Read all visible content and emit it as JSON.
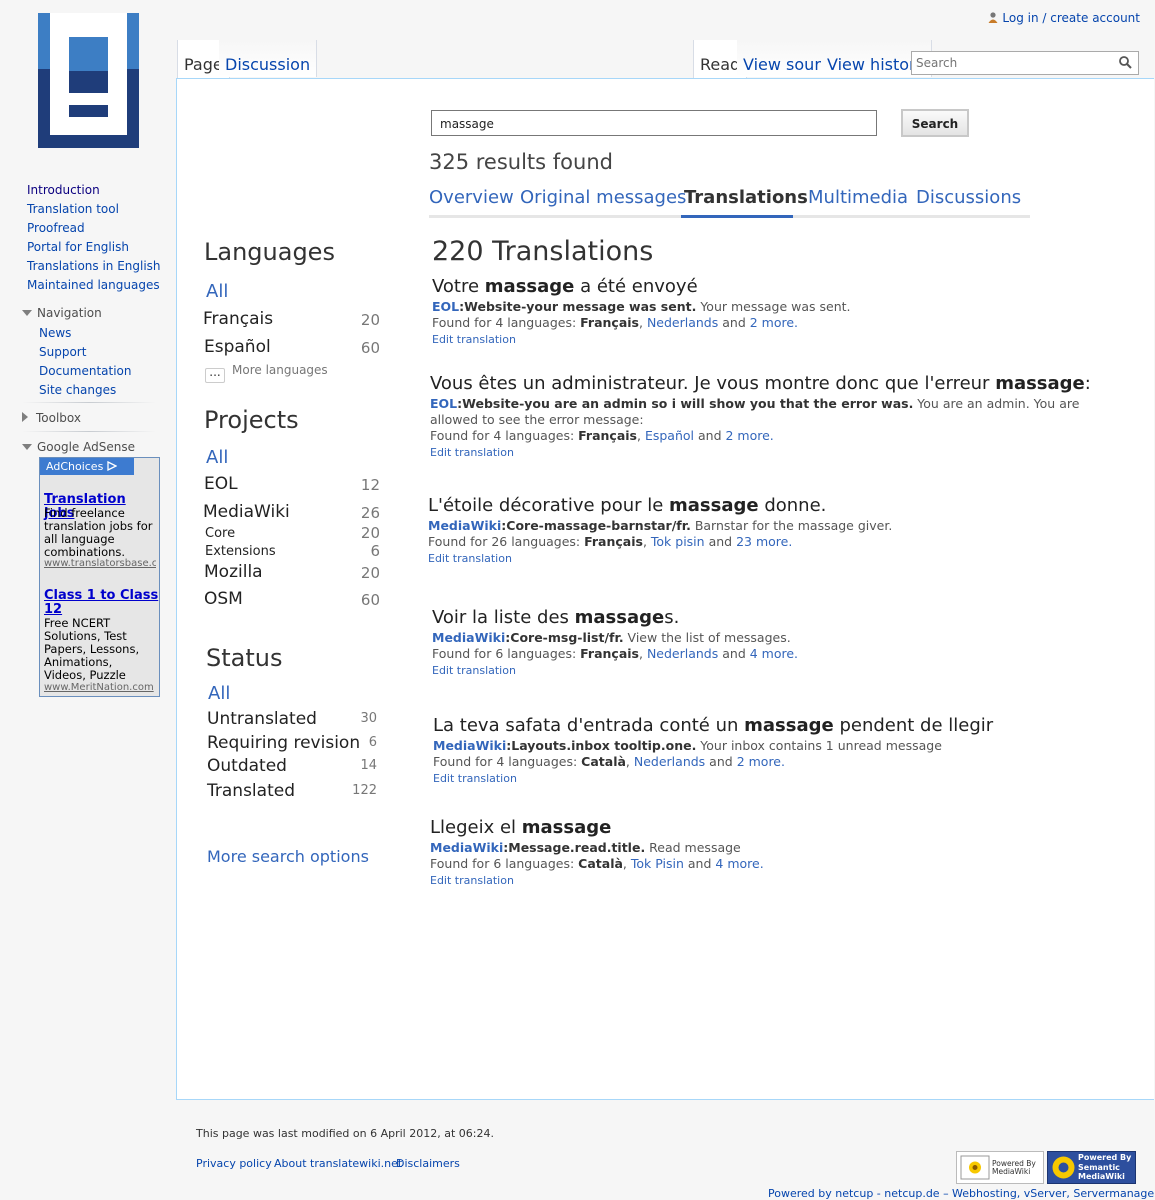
{
  "personal": {
    "login": "Log in / create account"
  },
  "tabs": {
    "page": "Page",
    "discussion": "Discussion",
    "read": "Read",
    "view_source": "View source",
    "view_history": "View history"
  },
  "top_search": {
    "placeholder": "Search"
  },
  "sidebar": {
    "main": [
      "Introduction",
      "Translation tool",
      "Proofread",
      "Portal for English",
      "Translations in English",
      "Maintained languages"
    ],
    "navigation": {
      "title": "Navigation",
      "items": [
        "News",
        "Support",
        "Documentation",
        "Site changes"
      ]
    },
    "toolbox": "Toolbox",
    "adsense": "Google AdSense"
  },
  "ad": {
    "choices": "AdChoices",
    "ad1": {
      "title": "Translation jobs",
      "text": "Find freelance translation jobs for all language combinations.",
      "url": "www.translatorsbase.com"
    },
    "ad2": {
      "title": "Class 1 to Class 12",
      "text": "Free NCERT Solutions, Test Papers, Lessons, Animations, Videos, Puzzle",
      "url": "www.MeritNation.com"
    }
  },
  "search": {
    "query": "massage",
    "button": "Search",
    "count": "325 results found",
    "tabs": [
      "Overview",
      "Original messages",
      "Translations",
      "Multimedia",
      "Discussions"
    ]
  },
  "facets": {
    "languages": {
      "title": "Languages",
      "all": "All",
      "items": [
        {
          "label": "Français",
          "count": "20"
        },
        {
          "label": "Español",
          "count": "60"
        }
      ],
      "more": "More languages",
      "dots": "..."
    },
    "projects": {
      "title": "Projects",
      "all": "All",
      "items": [
        {
          "label": "EOL",
          "count": "12"
        },
        {
          "label": "MediaWiki",
          "count": "26"
        },
        {
          "label": "Core",
          "count": "20"
        },
        {
          "label": "Extensions",
          "count": "6"
        },
        {
          "label": "Mozilla",
          "count": "20"
        },
        {
          "label": "OSM",
          "count": "60"
        }
      ]
    },
    "status": {
      "title": "Status",
      "all": "All",
      "items": [
        {
          "label": "Untranslated",
          "count": "30"
        },
        {
          "label": "Requiring revision",
          "count": "6"
        },
        {
          "label": "Outdated",
          "count": "14"
        },
        {
          "label": "Translated",
          "count": "122"
        }
      ]
    },
    "more_options": "More search options"
  },
  "results": {
    "heading": "220 Translations",
    "edit_label": "Edit translation",
    "found_for": "Found for",
    "and": "and",
    "items": [
      {
        "pre": "Votre ",
        "bold": "massage",
        "post": " a été envoyé",
        "project": "EOL",
        "key": ":Website-your message was sent.",
        "desc": " Your message was sent.",
        "desc2": "",
        "langs": "4 languages:",
        "lang1": "Français",
        "lang2": "Nederlands",
        "more": "2 more."
      },
      {
        "pre": "Vous êtes un administrateur. Je vous montre donc que l'erreur ",
        "bold": "massage",
        "post": ":",
        "project": "EOL",
        "key": ":Website-you are an admin so i will show you that the error was.",
        "desc": " You are an admin. You are",
        "desc2": "allowed to see the error message:",
        "langs": "4 languages:",
        "lang1": "Français",
        "lang2": "Español",
        "more": "2 more."
      },
      {
        "pre": "L'étoile décorative pour le ",
        "bold": "massage",
        "post": " donne.",
        "project": "MediaWiki",
        "key": ":Core-massage-barnstar/fr.",
        "desc": " Barnstar for the massage giver.",
        "desc2": "",
        "langs": "26 languages:",
        "lang1": "Français",
        "lang2": "Tok pisin",
        "more": "23 more."
      },
      {
        "pre": "Voir la liste des ",
        "bold": "massage",
        "post": "s.",
        "project": "MediaWiki",
        "key": ":Core-msg-list/fr.",
        "desc": " View the list of messages.",
        "desc2": "",
        "langs": "6 languages:",
        "lang1": "Français",
        "lang2": "Nederlands",
        "more": "4 more."
      },
      {
        "pre": "La teva safata d'entrada conté un ",
        "bold": "massage",
        "post": " pendent de llegir",
        "project": "MediaWiki",
        "key": ":Layouts.inbox tooltip.one.",
        "desc": " Your inbox contains 1 unread message",
        "desc2": "",
        "langs": "4 languages:",
        "lang1": "Català",
        "lang2": "Nederlands",
        "more": "2 more."
      },
      {
        "pre": "Llegeix el ",
        "bold": "massage",
        "post": "",
        "project": "MediaWiki",
        "key": ":Message.read.title.",
        "desc": " Read message",
        "desc2": "",
        "langs": "6 languages:",
        "lang1": "Català",
        "lang2": "Tok Pisin",
        "more": "4 more."
      }
    ]
  },
  "footer": {
    "modified": "This page was last modified on 6 April 2012, at 06:24.",
    "links": [
      "Privacy policy",
      "About translatewiki.net",
      "Disclaimers"
    ],
    "powered_mw": "Powered By MediaWiki",
    "powered_smw": "Powered By Semantic MediaWiki",
    "hosting": "Powered by netcup - netcup.de – Webhosting, vServer, Servermanagement"
  },
  "colors": {
    "accent": "#3366bb",
    "link": "#0645ad",
    "logo_dark": "#1f3d7a",
    "logo_light": "#3d7ec4"
  }
}
